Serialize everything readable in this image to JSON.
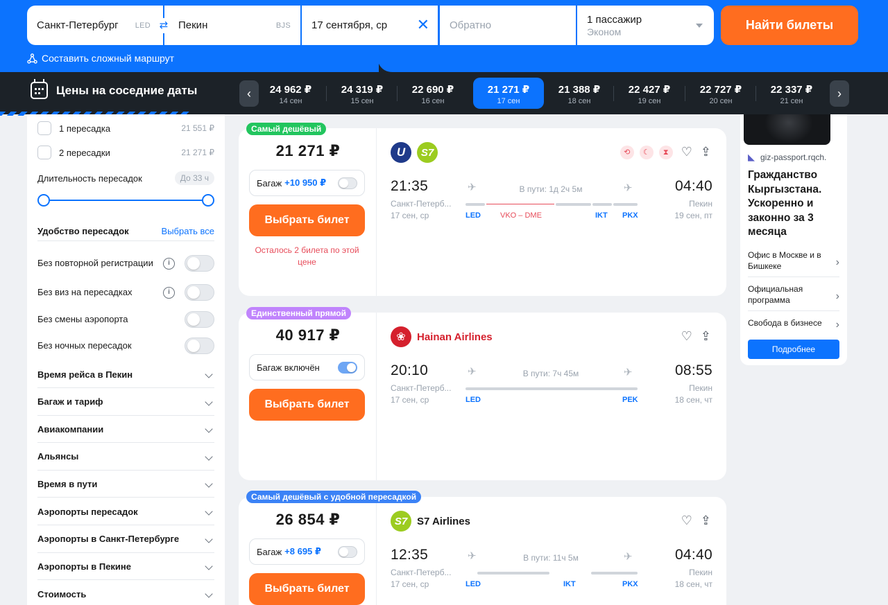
{
  "search": {
    "from_city": "Санкт-Петербург",
    "from_code": "LED",
    "to_city": "Пекин",
    "to_code": "BJS",
    "date": "17 сентября, ср",
    "return_placeholder": "Обратно",
    "passengers": "1 пассажир",
    "class": "Эконом",
    "find_label": "Найти билеты",
    "complex_route": "Составить сложный маршрут"
  },
  "date_bar": {
    "title": "Цены на соседние даты",
    "dates": [
      {
        "price": "24 962 ₽",
        "date": "14 сен"
      },
      {
        "price": "24 319 ₽",
        "date": "15 сен"
      },
      {
        "price": "22 690 ₽",
        "date": "16 сен"
      },
      {
        "price": "21 271 ₽",
        "date": "17 сен",
        "selected": true
      },
      {
        "price": "21 388 ₽",
        "date": "18 сен"
      },
      {
        "price": "22 427 ₽",
        "date": "19 сен"
      },
      {
        "price": "22 727 ₽",
        "date": "20 сен"
      },
      {
        "price": "22 337 ₽",
        "date": "21 сен"
      }
    ]
  },
  "filters": {
    "stops": [
      {
        "label": "1 пересадка",
        "price": "21 551 ₽"
      },
      {
        "label": "2 пересадки",
        "price": "21 271 ₽"
      }
    ],
    "layover_label": "Длительность пересадок",
    "layover_value": "До 33 ч",
    "layover_range": [
      0,
      1
    ],
    "comfort_title": "Удобство пересадок",
    "select_all": "Выбрать все",
    "toggles": [
      {
        "label": "Без повторной регистрации",
        "info": true
      },
      {
        "label": "Без виз на пересадках",
        "info": true
      },
      {
        "label": "Без смены аэропорта",
        "info": false
      },
      {
        "label": "Без ночных пересадок",
        "info": false
      }
    ],
    "sections": [
      "Время рейса в Пекин",
      "Багаж и тариф",
      "Авиакомпании",
      "Альянсы",
      "Время в пути",
      "Аэропорты пересадок",
      "Аэропорты в Санкт-Петербурге",
      "Аэропорты в Пекине",
      "Стоимость"
    ]
  },
  "results": [
    {
      "label": "Самый дешёвый",
      "label_color": "#22c55e",
      "price": "21 271 ₽",
      "baggage_text": "Багаж",
      "baggage_extra": "+10 950 ₽",
      "baggage_on": false,
      "select_label": "Выбрать билет",
      "warning": "Осталось 2 билета по этой цене",
      "airline_name": "",
      "dep_time": "21:35",
      "dep_city": "Санкт-Петерб...",
      "dep_date": "17 сен, ср",
      "duration": "В пути: 1д 2ч 5м",
      "arr_time": "04:40",
      "arr_city": "Пекин",
      "arr_date": "19 сен, пт",
      "airports": [
        "LED",
        "VKO – DME",
        "IKT",
        "PKX"
      ]
    },
    {
      "label": "Единственный прямой",
      "label_color": "#c084fc",
      "price": "40 917 ₽",
      "baggage_text": "Багаж включён",
      "baggage_extra": "",
      "baggage_on": true,
      "select_label": "Выбрать билет",
      "warning": "",
      "airline_name": "Hainan Airlines",
      "dep_time": "20:10",
      "dep_city": "Санкт-Петерб...",
      "dep_date": "17 сен, ср",
      "duration": "В пути: 7ч 45м",
      "arr_time": "08:55",
      "arr_city": "Пекин",
      "arr_date": "18 сен, чт",
      "airports": [
        "LED",
        "PEK"
      ]
    },
    {
      "label": "Самый дешёвый с удобной пересадкой",
      "label_color": "#3b82f6",
      "price": "26 854 ₽",
      "baggage_text": "Багаж",
      "baggage_extra": "+8 695 ₽",
      "baggage_on": false,
      "select_label": "Выбрать билет",
      "warning": "",
      "airline_name": "S7 Airlines",
      "dep_time": "12:35",
      "dep_city": "Санкт-Петерб...",
      "dep_date": "17 сен, ср",
      "duration": "В пути: 11ч 5м",
      "arr_time": "04:40",
      "arr_city": "Пекин",
      "arr_date": "18 сен, чт",
      "airports": [
        "LED",
        "IKT",
        "PKX"
      ]
    }
  ],
  "ad": {
    "domain": "giz-passport.rqch.",
    "headline": "Гражданство Кыргызстана. Ускоренно и законно за 3 месяца",
    "links": [
      "Офис в Москве и в Бишкеке",
      "Официальная программа",
      "Свобода в бизнесе"
    ],
    "cta": "Подробнее"
  },
  "colors": {
    "brand_blue": "#0c73fe",
    "accent_orange": "#ff6d1f",
    "dark_bar": "#1c2228",
    "alert_red": "#e74c5a"
  }
}
